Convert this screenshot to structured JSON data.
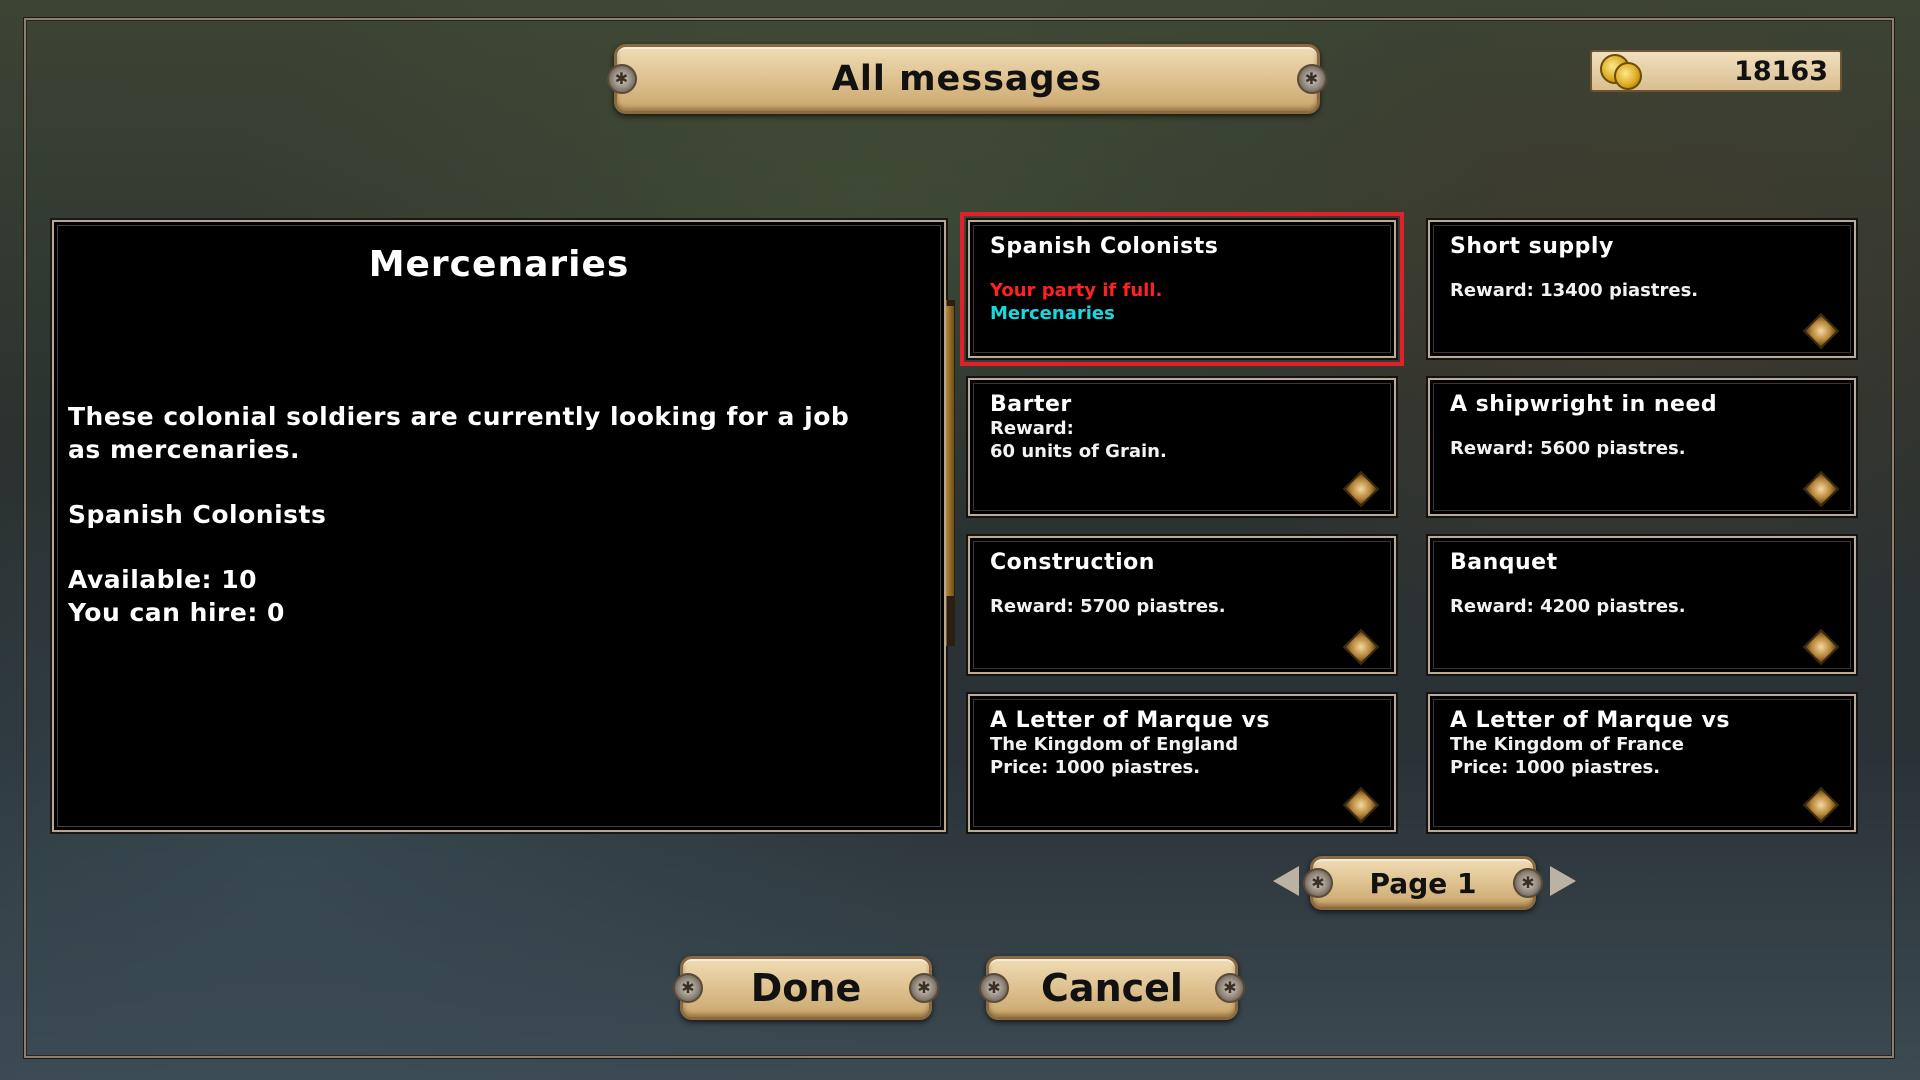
{
  "header": {
    "title": "All messages"
  },
  "money": {
    "amount": "18163",
    "icon": "gold-coins-icon"
  },
  "detail": {
    "title": "Mercenaries",
    "body_line1": "These colonial soldiers are currently looking for a job",
    "body_line2": "as mercenaries.",
    "group": "Spanish Colonists",
    "available": "Available: 10",
    "can_hire": "You can hire: 0"
  },
  "messages": [
    {
      "title": "Spanish Colonists",
      "lines": [
        "Your party if full.",
        "Mercenaries"
      ],
      "selected": true
    },
    {
      "title": "Short supply",
      "lines": [
        "Reward: 13400 piastres."
      ]
    },
    {
      "title": "Barter",
      "lines": [
        "Reward:",
        "60 units of Grain."
      ]
    },
    {
      "title": "A shipwright in need",
      "lines": [
        "Reward: 5600 piastres."
      ]
    },
    {
      "title": "Construction",
      "lines": [
        "Reward: 5700 piastres."
      ]
    },
    {
      "title": "Banquet",
      "lines": [
        "Reward: 4200 piastres."
      ]
    },
    {
      "title": "A Letter of Marque vs",
      "lines": [
        "The Kingdom of England",
        "Price: 1000 piastres."
      ]
    },
    {
      "title": "A Letter of Marque vs",
      "lines": [
        "The Kingdom of France",
        "Price: 1000 piastres."
      ]
    }
  ],
  "pager": {
    "label": "Page 1"
  },
  "buttons": {
    "done": "Done",
    "cancel": "Cancel"
  },
  "colors": {
    "selected_outline": "#e0202a",
    "warning_text": "#ff2222",
    "link_text": "#19d7df",
    "parchment": "#e0c493"
  }
}
